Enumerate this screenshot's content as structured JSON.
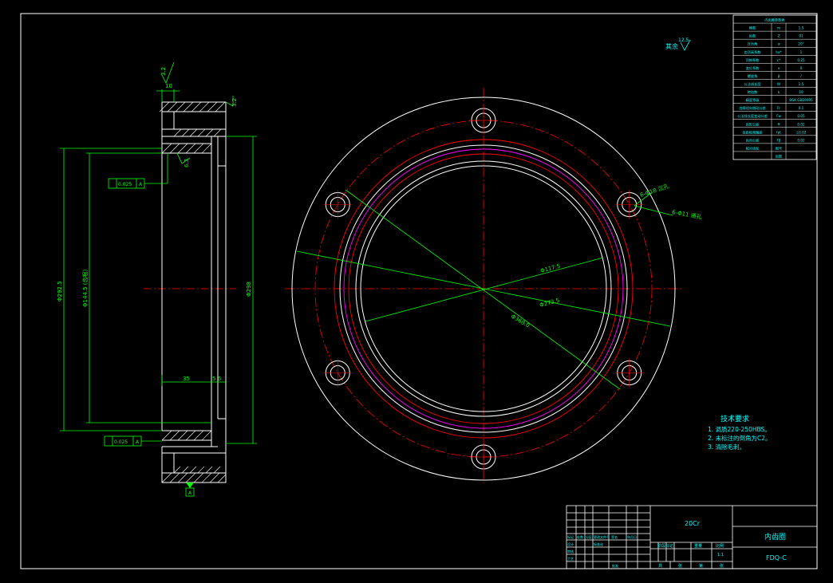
{
  "colors": {
    "background": "#000000",
    "frame": "#ffffff",
    "dimension": "#00ff00",
    "centerline": "#ff0000",
    "pitch_circle": "#ff00ff",
    "note_text": "#00ffff",
    "table_text": "#00ffff"
  },
  "params_table": {
    "rows": [
      [
        "内齿圈参数表",
        "",
        ""
      ],
      [
        "模数",
        "m",
        "1.5"
      ],
      [
        "齿数",
        "Z",
        "91"
      ],
      [
        "压力角",
        "α",
        "20°"
      ],
      [
        "齿顶高系数",
        "ha*",
        "1"
      ],
      [
        "顶隙系数",
        "c*",
        "0.25"
      ],
      [
        "变位系数",
        "x",
        "0"
      ],
      [
        "螺旋角",
        "β",
        "/"
      ],
      [
        "公法线长度",
        "W",
        "1.5"
      ],
      [
        "跨齿数",
        "k",
        "10"
      ],
      [
        "精度等级",
        "",
        "8GK GB10095"
      ],
      [
        "齿圈径向跳动公差",
        "Fr",
        "0.1"
      ],
      [
        "公法线长度变动公差",
        "Fw",
        "0.05"
      ],
      [
        "齿形公差",
        "ff",
        "0.02"
      ],
      [
        "齿距极限偏差",
        "fpt",
        "±0.02"
      ],
      [
        "齿向公差",
        "Fβ",
        "0.02"
      ],
      [
        "配对齿轮",
        "图号",
        ""
      ],
      [
        "",
        "齿数",
        ""
      ]
    ]
  },
  "roughness_note": {
    "prefix": "其余",
    "value": "12.5"
  },
  "section_view": {
    "roughness_top": "3.2",
    "roughness_right": "3.2",
    "roughness_bore": "6.3",
    "dim_top": "10",
    "tol_upper": "0.025",
    "tol_lower": "0.025",
    "datum": "A",
    "dim_outer": "Φ292.5",
    "dim_root": "Φ144.5 (齿根)",
    "dim_right": "Φ298",
    "dim_width": "35",
    "dim_groove": "5  6"
  },
  "front_view": {
    "dim_bolt_hole": "6-Φ18 沉孔",
    "dim_bolt_thread": "6-Φ11 通孔",
    "dim_inner": "Φ117.5",
    "dim_pitch": "Φ273.5",
    "dim_outer": "Φ368.0"
  },
  "tech_requirements": {
    "title": "技术要求",
    "items": [
      "1. 调质220-250HBS。",
      "2. 未标注的倒角为C2。",
      "3. 清除毛刺。"
    ]
  },
  "title_block": {
    "material": "20Cr",
    "part_name": "内齿圈",
    "drawing_no": "FDQ-C",
    "scale_label": "比例",
    "scale_value": "1:1",
    "stage_labels": [
      "阶段标记",
      "重量",
      "比例"
    ],
    "bottom_labels": [
      "共",
      "张",
      "第",
      "张"
    ],
    "sign_labels": [
      "标记",
      "处数",
      "分区",
      "更改文件号",
      "签名",
      "年月日"
    ],
    "role_labels": [
      "设计",
      "标准化",
      "审核",
      "工艺",
      "批准"
    ]
  }
}
